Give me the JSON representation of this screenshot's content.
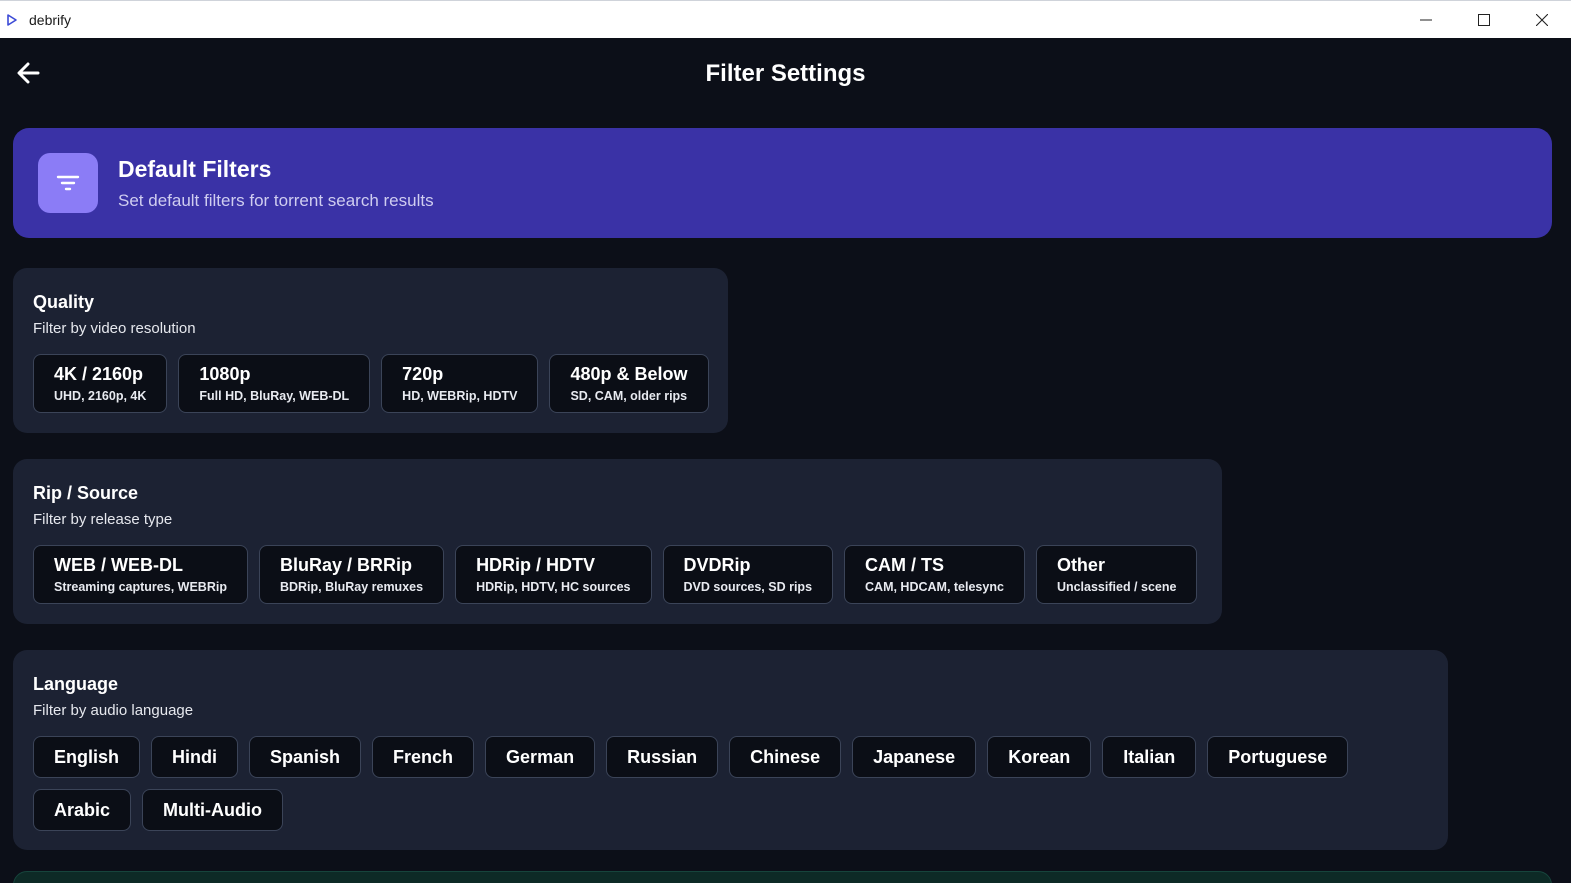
{
  "window": {
    "title": "debrify"
  },
  "header": {
    "back_icon": "arrow-left-icon",
    "title": "Filter Settings"
  },
  "hero": {
    "icon": "filter-icon",
    "title": "Default Filters",
    "subtitle": "Set default filters for torrent search results",
    "bg_color": "#3a32a6"
  },
  "quality": {
    "title": "Quality",
    "subtitle": "Filter by video resolution",
    "options": [
      {
        "label": "4K / 2160p",
        "desc": "UHD, 2160p, 4K"
      },
      {
        "label": "1080p",
        "desc": "Full HD, BluRay, WEB-DL"
      },
      {
        "label": "720p",
        "desc": "HD, WEBRip, HDTV"
      },
      {
        "label": "480p & Below",
        "desc": "SD, CAM, older rips"
      }
    ]
  },
  "rip": {
    "title": "Rip / Source",
    "subtitle": "Filter by release type",
    "options": [
      {
        "label": "WEB / WEB-DL",
        "desc": "Streaming captures, WEBRip"
      },
      {
        "label": "BluRay / BRRip",
        "desc": "BDRip, BluRay remuxes"
      },
      {
        "label": "HDRip / HDTV",
        "desc": "HDRip, HDTV, HC sources"
      },
      {
        "label": "DVDRip",
        "desc": "DVD sources, SD rips"
      },
      {
        "label": "CAM / TS",
        "desc": "CAM, HDCAM, telesync"
      },
      {
        "label": "Other",
        "desc": "Unclassified / scene"
      }
    ]
  },
  "language": {
    "title": "Language",
    "subtitle": "Filter by audio language",
    "options": [
      "English",
      "Hindi",
      "Spanish",
      "French",
      "German",
      "Russian",
      "Chinese",
      "Japanese",
      "Korean",
      "Italian",
      "Portuguese",
      "Arabic",
      "Multi-Audio"
    ]
  }
}
